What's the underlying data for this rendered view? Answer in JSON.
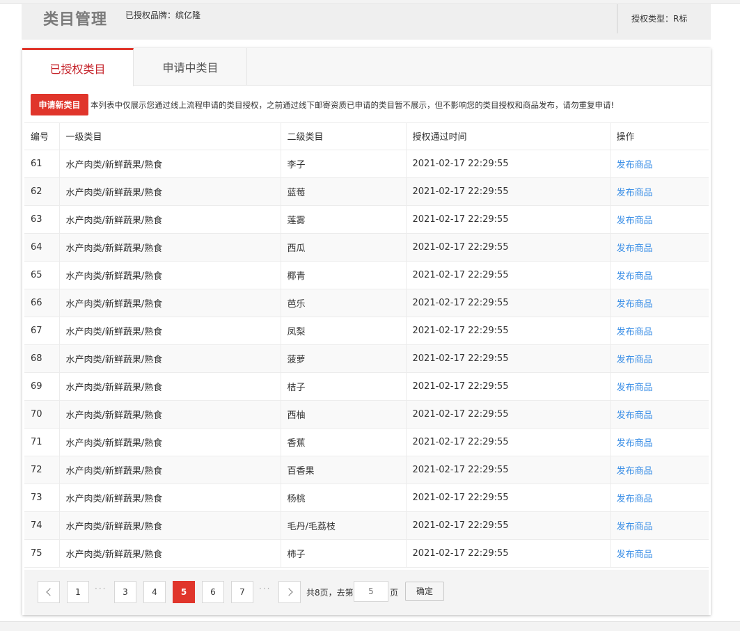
{
  "header": {
    "title": "类目管理",
    "brand": "已授权品牌：缤亿隆",
    "auth_type": "授权类型：R标"
  },
  "tabs": [
    {
      "label": "已授权类目",
      "active": true
    },
    {
      "label": "申请中类目",
      "active": false
    }
  ],
  "notice": {
    "apply_button": "申请新类目",
    "text": "本列表中仅展示您通过线上流程申请的类目授权，之前通过线下邮寄资质已申请的类目暂不展示，但不影响您的类目授权和商品发布，请勿重复申请!"
  },
  "table": {
    "columns": [
      "编号",
      "一级类目",
      "二级类目",
      "授权通过时间",
      "操作"
    ],
    "rows": [
      {
        "id": "61",
        "level1": "水产肉类/新鲜蔬果/熟食",
        "level2": "李子",
        "time": "2021-02-17 22:29:55",
        "action": "发布商品"
      },
      {
        "id": "62",
        "level1": "水产肉类/新鲜蔬果/熟食",
        "level2": "蓝莓",
        "time": "2021-02-17 22:29:55",
        "action": "发布商品"
      },
      {
        "id": "63",
        "level1": "水产肉类/新鲜蔬果/熟食",
        "level2": "莲雾",
        "time": "2021-02-17 22:29:55",
        "action": "发布商品"
      },
      {
        "id": "64",
        "level1": "水产肉类/新鲜蔬果/熟食",
        "level2": "西瓜",
        "time": "2021-02-17 22:29:55",
        "action": "发布商品"
      },
      {
        "id": "65",
        "level1": "水产肉类/新鲜蔬果/熟食",
        "level2": "椰青",
        "time": "2021-02-17 22:29:55",
        "action": "发布商品"
      },
      {
        "id": "66",
        "level1": "水产肉类/新鲜蔬果/熟食",
        "level2": "芭乐",
        "time": "2021-02-17 22:29:55",
        "action": "发布商品"
      },
      {
        "id": "67",
        "level1": "水产肉类/新鲜蔬果/熟食",
        "level2": "凤梨",
        "time": "2021-02-17 22:29:55",
        "action": "发布商品"
      },
      {
        "id": "68",
        "level1": "水产肉类/新鲜蔬果/熟食",
        "level2": "菠萝",
        "time": "2021-02-17 22:29:55",
        "action": "发布商品"
      },
      {
        "id": "69",
        "level1": "水产肉类/新鲜蔬果/熟食",
        "level2": "桔子",
        "time": "2021-02-17 22:29:55",
        "action": "发布商品"
      },
      {
        "id": "70",
        "level1": "水产肉类/新鲜蔬果/熟食",
        "level2": "西柚",
        "time": "2021-02-17 22:29:55",
        "action": "发布商品"
      },
      {
        "id": "71",
        "level1": "水产肉类/新鲜蔬果/熟食",
        "level2": "香蕉",
        "time": "2021-02-17 22:29:55",
        "action": "发布商品"
      },
      {
        "id": "72",
        "level1": "水产肉类/新鲜蔬果/熟食",
        "level2": "百香果",
        "time": "2021-02-17 22:29:55",
        "action": "发布商品"
      },
      {
        "id": "73",
        "level1": "水产肉类/新鲜蔬果/熟食",
        "level2": "杨桃",
        "time": "2021-02-17 22:29:55",
        "action": "发布商品"
      },
      {
        "id": "74",
        "level1": "水产肉类/新鲜蔬果/熟食",
        "level2": "毛丹/毛荔枝",
        "time": "2021-02-17 22:29:55",
        "action": "发布商品"
      },
      {
        "id": "75",
        "level1": "水产肉类/新鲜蔬果/熟食",
        "level2": "柿子",
        "time": "2021-02-17 22:29:55",
        "action": "发布商品"
      }
    ]
  },
  "pagination": {
    "prev_icon": "chevron-left-icon",
    "next_icon": "chevron-right-icon",
    "pages": [
      "1",
      "3",
      "4",
      "5",
      "6",
      "7"
    ],
    "current": "5",
    "ellipsis": "···",
    "total_text": "共8页，去第",
    "goto_value": "5",
    "page_unit": "页",
    "confirm_label": "确定"
  },
  "colors": {
    "accent": "#e0352b",
    "link": "#3a8ee6"
  }
}
